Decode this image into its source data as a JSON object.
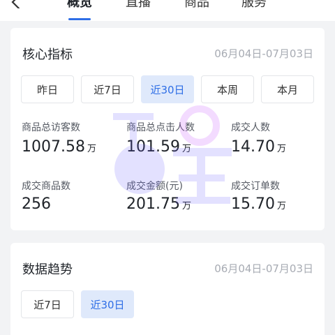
{
  "nav": {
    "back_icon": "chevron-left-icon",
    "tabs": [
      {
        "label": "概览",
        "active": true
      },
      {
        "label": "直播",
        "active": false
      },
      {
        "label": "商品",
        "active": false
      },
      {
        "label": "服务",
        "active": false
      }
    ]
  },
  "core_metrics": {
    "title": "核心指标",
    "date_range": "06月04日-07月03日",
    "filters": [
      {
        "label": "昨日",
        "selected": false
      },
      {
        "label": "近7日",
        "selected": false
      },
      {
        "label": "近30日",
        "selected": true
      },
      {
        "label": "本周",
        "selected": false
      },
      {
        "label": "本月",
        "selected": false
      }
    ],
    "metrics": [
      {
        "label": "商品总访客数",
        "value": "1007.58",
        "unit": "万"
      },
      {
        "label": "商品总点击人数",
        "value": "101.59",
        "unit": "万"
      },
      {
        "label": "成交人数",
        "value": "14.70",
        "unit": "万"
      },
      {
        "label": "成交商品数",
        "value": "256",
        "unit": ""
      },
      {
        "label": "成交金额(元)",
        "value": "201.75",
        "unit": "万"
      },
      {
        "label": "成交订单数",
        "value": "15.70",
        "unit": "万"
      }
    ]
  },
  "trend": {
    "title": "数据趋势",
    "date_range": "06月04日-07月03日",
    "filters": [
      {
        "label": "近7日",
        "selected": false
      },
      {
        "label": "近30日",
        "selected": true
      }
    ]
  },
  "colors": {
    "accent": "#2e6ee6",
    "selected_bg": "#dfe9fb",
    "page_bg": "#f2f3f5"
  },
  "watermark_icon": "brand-watermark-icon"
}
